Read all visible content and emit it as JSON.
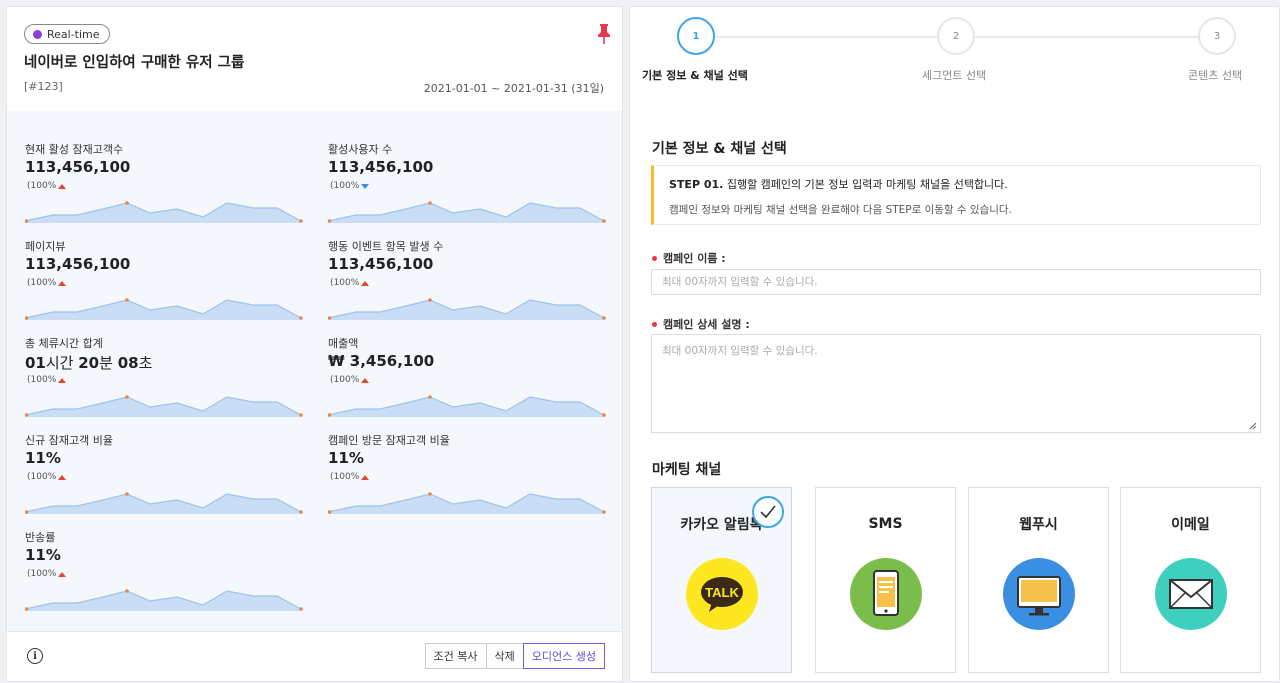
{
  "left_panel": {
    "badge": "Real-time",
    "title": "네이버로 인입하여 구매한 유저 그룹",
    "id": "[#123]",
    "period": "2021-01-01 ~ 2021-01-31 (31일)",
    "metrics": [
      {
        "label": "현재 활성 잠재고객수",
        "value": "113,456,100",
        "change": "(100%",
        "trend": "up"
      },
      {
        "label": "활성사용자 수",
        "value": "113,456,100",
        "change": "(100%",
        "trend": "down"
      },
      {
        "label": "페이지뷰",
        "value": "113,456,100",
        "change": "(100%",
        "trend": "up"
      },
      {
        "label": "행동 이벤트 항목 발생 수",
        "value": "113,456,100",
        "change": "(100%",
        "trend": "up"
      },
      {
        "label": "총 체류시간 합계",
        "value_parts": [
          "01",
          "시간 ",
          "20",
          "분 ",
          "08",
          "초"
        ],
        "change": "(100%",
        "trend": "up"
      },
      {
        "label": "매출액",
        "value": "₩ 3,456,100",
        "change": "(100%",
        "trend": "up"
      },
      {
        "label": "신규 잠재고객 비율",
        "value": "11%",
        "change": "(100%",
        "trend": "up"
      },
      {
        "label": "캠페인 방문 잠재고객 비율",
        "value": "11%",
        "change": "(100%",
        "trend": "up"
      },
      {
        "label": "반송률",
        "value": "11%",
        "change": "(100%",
        "trend": "up"
      }
    ],
    "buttons": {
      "copy": "조건 복사",
      "delete": "삭제",
      "create": "오디언스 생성"
    }
  },
  "right_panel": {
    "steps": [
      {
        "num": "1",
        "label": "기본 정보 & 채널 선택",
        "active": true
      },
      {
        "num": "2",
        "label": "세그먼트 선택",
        "active": false
      },
      {
        "num": "3",
        "label": "콘텐츠 선택",
        "active": false
      }
    ],
    "section_title": "기본 정보 & 채널 선택",
    "callout": {
      "step_tag": "STEP 01.",
      "line1": " 집행할 캠페인의 기본 정보 입력과 마케팅 채널을 선택합니다.",
      "line2": "캠페인 정보와 마케팅 채널 선택을 완료해야 다음 STEP로 이동할 수 있습니다."
    },
    "campaign_name": {
      "label": "캠페인 이름 :",
      "placeholder": "최대 00자까지 입력할 수 있습니다."
    },
    "campaign_desc": {
      "label": "캠페인 상세 설명 :",
      "placeholder": "최대 00자까지 입력할 수 있습니다."
    },
    "channels_title": "마케팅 채널",
    "channels": [
      {
        "name": "카카오 알림톡",
        "icon": "kakao-talk-icon",
        "selected": true,
        "icon_text": "TALK"
      },
      {
        "name": "SMS",
        "icon": "mobile-phone-icon",
        "selected": false
      },
      {
        "name": "웹푸시",
        "icon": "monitor-icon",
        "selected": false
      },
      {
        "name": "이메일",
        "icon": "envelope-icon",
        "selected": false
      }
    ]
  },
  "colors": {
    "accent": "#3ba6e8",
    "primary_button": "#5a4fcf",
    "callout_bar": "#f6bd23",
    "trend_up": "#e3472f",
    "trend_down": "#3a8fe3"
  }
}
